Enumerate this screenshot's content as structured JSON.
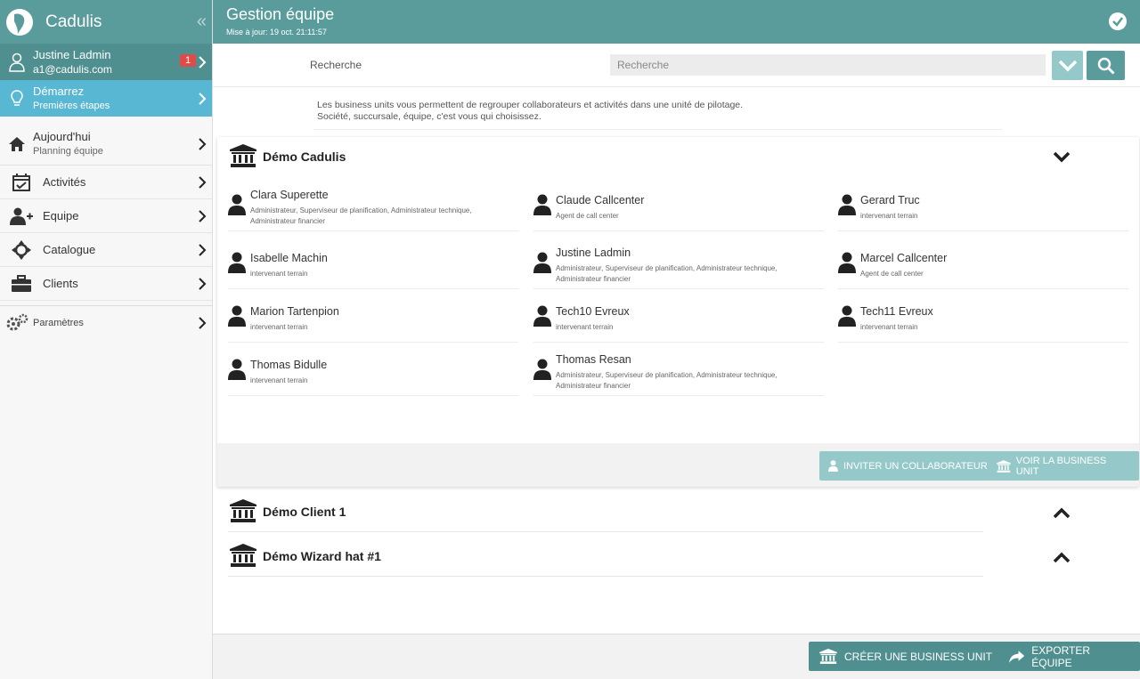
{
  "app": {
    "name": "Cadulis"
  },
  "sidebar": {
    "user": {
      "name": "Justine Ladmin",
      "email": "a1@cadulis.com",
      "badge": "1"
    },
    "start": {
      "title": "Démarrez",
      "subtitle": "Premières étapes"
    },
    "today": {
      "title": "Aujourd'hui",
      "subtitle": "Planning équipe"
    },
    "items": [
      {
        "label": "Activités",
        "icon": "calendar-check-icon"
      },
      {
        "label": "Equipe",
        "icon": "user-plus-icon"
      },
      {
        "label": "Catalogue",
        "icon": "crosshair-icon"
      },
      {
        "label": "Clients",
        "icon": "briefcase-icon"
      }
    ],
    "params": {
      "label": "Paramètres"
    }
  },
  "header": {
    "title": "Gestion équipe",
    "updated": "Mise à jour: 19 oct. 21:11:57"
  },
  "search": {
    "label": "Recherche",
    "placeholder": "Recherche"
  },
  "info": {
    "line1": "Les business units vous permettent de regrouper collaborateurs et activités dans une unité de pilotage.",
    "line2": "Société, succursale, équipe, c'est vous qui choisissez."
  },
  "business_units": [
    {
      "name": "Démo Cadulis",
      "members": [
        {
          "name": "Clara Superette",
          "role": "Administrateur, Superviseur de planification, Administrateur technique, Administrateur financier"
        },
        {
          "name": "Claude Callcenter",
          "role": "Agent de call center"
        },
        {
          "name": "Gerard Truc",
          "role": "intervenant terrain"
        },
        {
          "name": "Isabelle Machin",
          "role": "intervenant terrain"
        },
        {
          "name": "Justine Ladmin",
          "role": "Administrateur, Superviseur de planification, Administrateur technique, Administrateur financier"
        },
        {
          "name": "Marcel Callcenter",
          "role": "Agent de call center"
        },
        {
          "name": "Marion Tartenpion",
          "role": "intervenant terrain"
        },
        {
          "name": "Tech10 Evreux",
          "role": "intervenant terrain"
        },
        {
          "name": "Tech11 Evreux",
          "role": "intervenant terrain"
        },
        {
          "name": "Thomas Bidulle",
          "role": "intervenant terrain"
        },
        {
          "name": "Thomas Resan",
          "role": "Administrateur, Superviseur de planification, Administrateur technique, Administrateur financier"
        }
      ],
      "actions": {
        "invite": "INVITER UN COLLABORATEUR",
        "view": "VOIR LA BUSINESS UNIT"
      }
    },
    {
      "name": "Démo Client 1"
    },
    {
      "name": "Démo Wizard hat #1"
    }
  ],
  "footer": {
    "create": "CRÉER UNE BUSINESS UNIT",
    "export": "EXPORTER ÉQUIPE"
  },
  "colors": {
    "primary": "#5a9c9c",
    "primary_dark": "#4f8f8f",
    "primary_light": "#95c9c9",
    "start": "#58b7d3",
    "badge": "#e04b47"
  }
}
